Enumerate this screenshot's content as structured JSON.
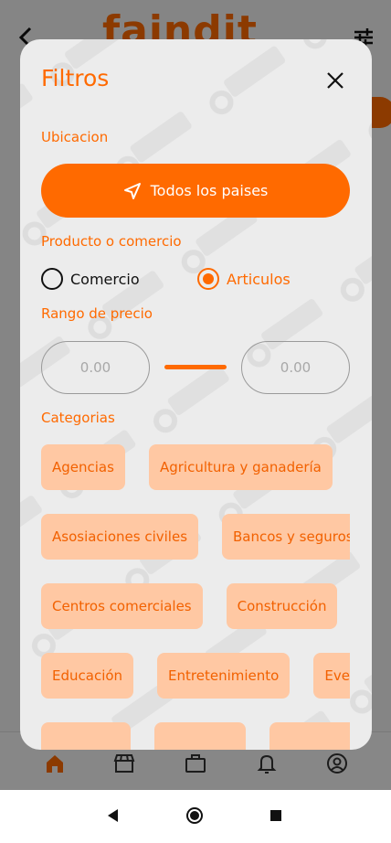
{
  "app": {
    "logo_text": "faindit",
    "accent_color": "#ff6a00"
  },
  "header": {
    "back_icon": "chevron-left-icon",
    "filter_icon": "tune-icon"
  },
  "bottom_nav": {
    "items": [
      {
        "name": "home",
        "icon": "home-icon",
        "active": true
      },
      {
        "name": "store",
        "icon": "store-icon"
      },
      {
        "name": "briefcase",
        "icon": "briefcase-icon"
      },
      {
        "name": "notifications",
        "icon": "bell-icon"
      },
      {
        "name": "profile",
        "icon": "user-circle-icon"
      }
    ]
  },
  "filters": {
    "title": "Filtros",
    "location": {
      "label": "Ubicacion",
      "button_label": "Todos los paises"
    },
    "type": {
      "label": "Producto o comercio",
      "options": [
        {
          "label": "Comercio",
          "selected": false
        },
        {
          "label": "Articulos",
          "selected": true
        }
      ]
    },
    "price": {
      "label": "Rango de precio",
      "min_placeholder": "0.00",
      "max_placeholder": "0.00"
    },
    "categories": {
      "label": "Categorias",
      "rows": [
        [
          "Agencias",
          "Agricultura y ganadería"
        ],
        [
          "Asosiaciones civiles",
          "Bancos y seguros"
        ],
        [
          "Centros comerciales",
          "Construcción"
        ],
        [
          "Educación",
          "Entretenimiento",
          "Eventos"
        ],
        [
          "",
          "",
          ""
        ]
      ]
    }
  }
}
